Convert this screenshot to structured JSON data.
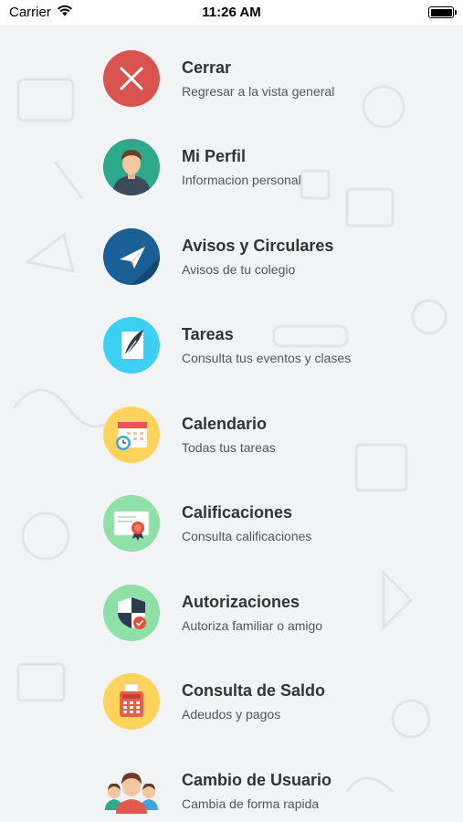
{
  "status_bar": {
    "carrier": "Carrier",
    "time": "11:26 AM"
  },
  "colors": {
    "background": "#f2f3f4",
    "cerrar": "#d9534f",
    "perfil": "#2eaa8a",
    "avisos": "#1a5f95",
    "tareas": "#3ed0f2",
    "calendario": "#ffd35c",
    "calificaciones": "#8ee0a6",
    "autorizaciones": "#8ee0a6",
    "saldo": "#ffd35c"
  },
  "menu": {
    "items": [
      {
        "icon": "close-icon",
        "title": "Cerrar",
        "subtitle": "Regresar a la vista general"
      },
      {
        "icon": "profile-icon",
        "title": "Mi Perfil",
        "subtitle": "Informacion personal"
      },
      {
        "icon": "paper-plane-icon",
        "title": "Avisos y Circulares",
        "subtitle": "Avisos de tu colegio"
      },
      {
        "icon": "feather-note-icon",
        "title": "Tareas",
        "subtitle": "Consulta tus eventos y clases"
      },
      {
        "icon": "calendar-clock-icon",
        "title": "Calendario",
        "subtitle": "Todas tus tareas"
      },
      {
        "icon": "certificate-icon",
        "title": "Calificaciones",
        "subtitle": "Consulta calificaciones"
      },
      {
        "icon": "shield-check-icon",
        "title": "Autorizaciones",
        "subtitle": "Autoriza familiar o amigo"
      },
      {
        "icon": "cash-register-icon",
        "title": "Consulta de Saldo",
        "subtitle": "Adeudos y pagos"
      },
      {
        "icon": "users-icon",
        "title": "Cambio de Usuario",
        "subtitle": "Cambia de forma rapida"
      }
    ]
  }
}
